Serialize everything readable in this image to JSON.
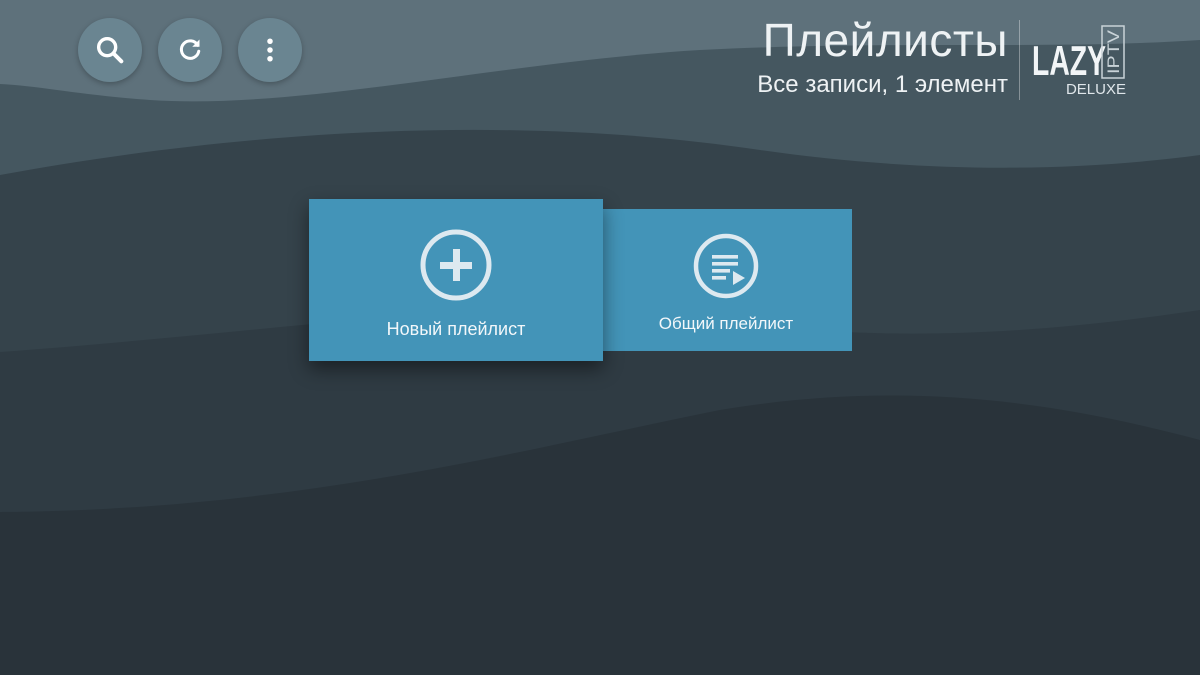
{
  "header": {
    "title": "Плейлисты",
    "subtitle": "Все записи, 1 элемент"
  },
  "logo": {
    "main": "LAZY",
    "vertical": "IPTV",
    "sub": "DELUXE"
  },
  "toolbar": {
    "buttons": [
      {
        "icon": "search-icon"
      },
      {
        "icon": "refresh-icon"
      },
      {
        "icon": "more-vertical-icon"
      }
    ]
  },
  "tiles": [
    {
      "label": "Новый плейлист",
      "icon": "add-circle-icon"
    },
    {
      "label": "Общий плейлист",
      "icon": "playlist-play-icon"
    }
  ],
  "colors": {
    "background_dark": "#29333a",
    "tile_blue": "#4394b8",
    "toolbar_button": "#6a8591",
    "text_light": "#eef2f4"
  }
}
